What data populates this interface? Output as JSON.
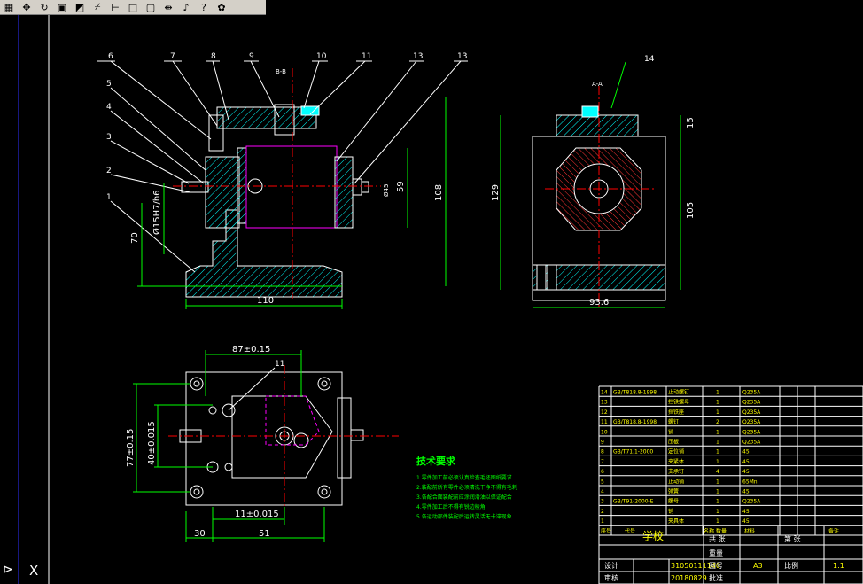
{
  "toolbar": {
    "buttons": [
      {
        "icon": "zoom-window-icon",
        "glyph": "▦"
      },
      {
        "icon": "pan-icon",
        "glyph": "✥"
      },
      {
        "icon": "regen-icon",
        "glyph": "↻"
      },
      {
        "icon": "zoom-previous-icon",
        "glyph": "▣"
      },
      {
        "icon": "properties-icon",
        "glyph": "◩"
      },
      {
        "icon": "snap-icon",
        "glyph": "⌿"
      },
      {
        "icon": "ortho-icon",
        "glyph": "⊢"
      },
      {
        "icon": "layer-icon",
        "glyph": "□"
      },
      {
        "icon": "block-icon",
        "glyph": "▢"
      },
      {
        "icon": "dimension-icon",
        "glyph": "⇹"
      },
      {
        "icon": "text-icon",
        "glyph": "♪"
      },
      {
        "icon": "help-icon",
        "glyph": "?"
      },
      {
        "icon": "plugin-icon",
        "glyph": "✿"
      }
    ]
  },
  "front_view": {
    "balloons": [
      "6",
      "7",
      "8",
      "9",
      "10",
      "11",
      "13",
      "13",
      "5",
      "4",
      "3",
      "2",
      "1"
    ],
    "section_label": "B-B",
    "dims": {
      "width": "110",
      "height": "108",
      "inner": "59",
      "fit": "Ø15H7/h6",
      "h70": "70",
      "small_dia": "Ø45"
    }
  },
  "side_view": {
    "section_label": "A-A",
    "balloon": "14",
    "dims": {
      "width": "93.6",
      "height": "129",
      "h105": "105",
      "h15": "15"
    }
  },
  "top_view": {
    "balloon": "11",
    "dims": {
      "d87": "87±0.15",
      "d77": "77±0.15",
      "d40": "40±0.015",
      "d11": "11±0.015",
      "d30": "30",
      "d51": "51"
    }
  },
  "tech": {
    "title": "技术要求",
    "lines": [
      "1.零件加工前必须认真检查毛坯图纸要求",
      "2.装配前所有零件必须清洗干净不得有毛刺",
      "3.各配合面装配前应涂润滑油以保证配合",
      "4.零件加工后不得有锐边棱角",
      "5.各运动部件装配后运转灵活无卡滞现象"
    ]
  },
  "bom": [
    {
      "no": "14",
      "code": "GB/T818.8-1998",
      "name": "止动螺钉",
      "qty": "1",
      "mat": "Q235A"
    },
    {
      "no": "13",
      "code": "",
      "name": "挡铁螺母",
      "qty": "1",
      "mat": "Q235A"
    },
    {
      "no": "12",
      "code": "",
      "name": "挡铁座",
      "qty": "1",
      "mat": "Q235A"
    },
    {
      "no": "11",
      "code": "GB/T818.8-1998",
      "name": "螺钉",
      "qty": "2",
      "mat": "Q235A"
    },
    {
      "no": "10",
      "code": "",
      "name": "销",
      "qty": "1",
      "mat": "Q235A"
    },
    {
      "no": "9",
      "code": "",
      "name": "压板",
      "qty": "1",
      "mat": "Q235A"
    },
    {
      "no": "8",
      "code": "GB/T71.1-2000",
      "name": "定位销",
      "qty": "1",
      "mat": "45"
    },
    {
      "no": "7",
      "code": "",
      "name": "夹紧体",
      "qty": "1",
      "mat": "45"
    },
    {
      "no": "6",
      "code": "",
      "name": "支承钉",
      "qty": "4",
      "mat": "45"
    },
    {
      "no": "5",
      "code": "",
      "name": "止动销",
      "qty": "1",
      "mat": "65Mn"
    },
    {
      "no": "4",
      "code": "",
      "name": "弹簧",
      "qty": "1",
      "mat": "45"
    },
    {
      "no": "3",
      "code": "GB/T91-2000-E",
      "name": "螺母",
      "qty": "1",
      "mat": "Q235A"
    },
    {
      "no": "2",
      "code": "",
      "name": "销",
      "qty": "1",
      "mat": "45"
    },
    {
      "no": "1",
      "code": "",
      "name": "夹具体",
      "qty": "1",
      "mat": "45"
    }
  ],
  "bom_header": {
    "no": "序号",
    "code": "代号",
    "name": "名称",
    "qty": "数量",
    "mat": "材料",
    "note": "备注"
  },
  "title_block": {
    "school": "学校",
    "scale_label": "比例",
    "scale": "1:1",
    "sheet_label": "共 张",
    "sheet2": "第 张",
    "designer_label": "设计",
    "designer": "",
    "student_id": "31050111140",
    "checker_label": "审核",
    "date_label": "日期",
    "date": "20180829",
    "size": "A3",
    "drawing_label": "图号",
    "weight_label": "重量",
    "std_label": "标准化",
    "approve_label": "批准",
    "total_label": "共 张"
  },
  "command": {
    "prompt": "X"
  },
  "colors": {
    "line": "#ffffff",
    "center": "#ff0000",
    "dim": "#00ff00",
    "hatch": "#00ffff",
    "hidden": "#ff00ff",
    "yellow": "#ffff00"
  }
}
